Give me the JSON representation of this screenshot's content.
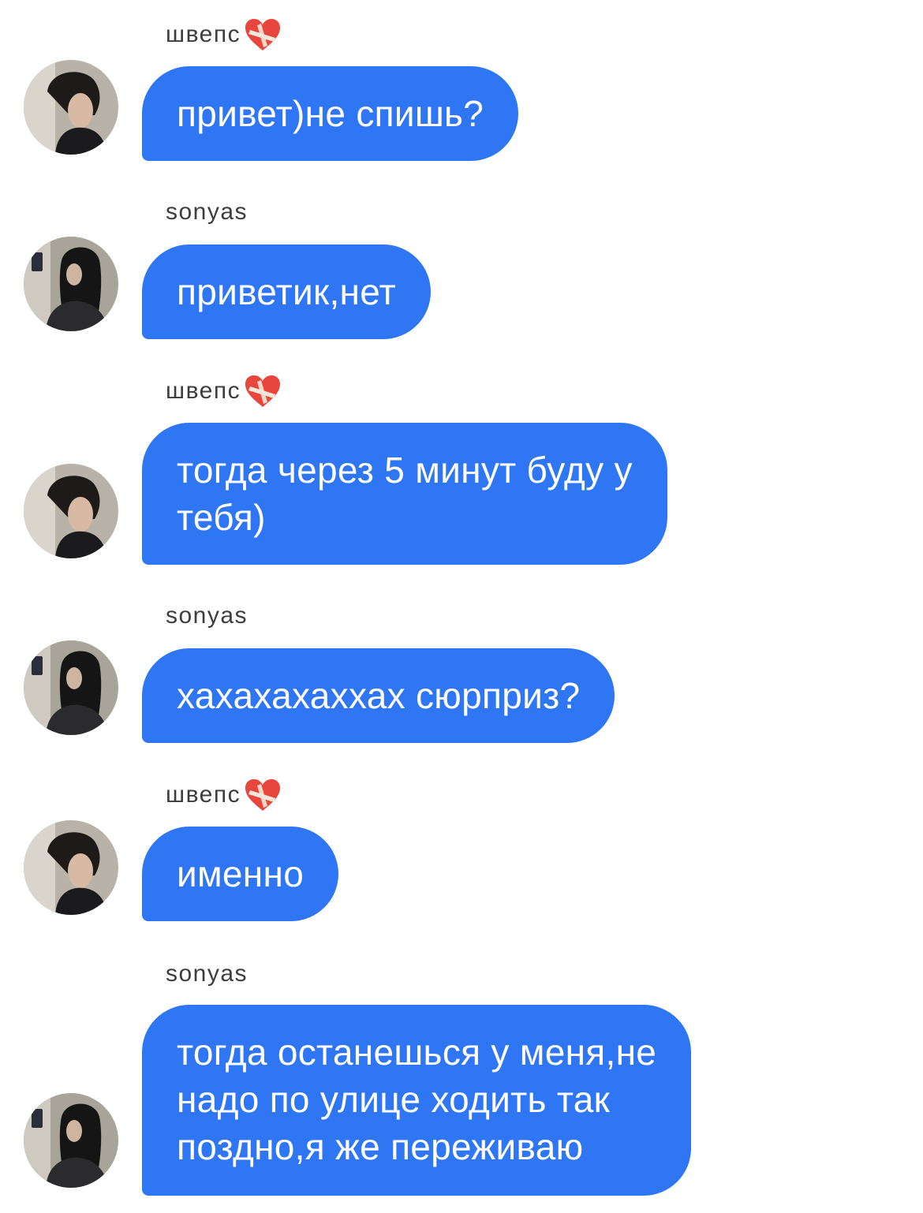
{
  "chat": {
    "messages": [
      {
        "sender": "швепс",
        "has_heart": true,
        "avatar": "guy-avatar",
        "text": "привет)не спишь?"
      },
      {
        "sender": "sonyas",
        "has_heart": false,
        "avatar": "girl-avatar",
        "text": "приветик,нет"
      },
      {
        "sender": "швепс",
        "has_heart": true,
        "avatar": "guy-avatar",
        "text": "тогда через 5 минут буду у\nтебя)"
      },
      {
        "sender": "sonyas",
        "has_heart": false,
        "avatar": "girl-avatar",
        "text": "хахахахаххах сюрприз?"
      },
      {
        "sender": "швепс",
        "has_heart": true,
        "avatar": "guy-avatar",
        "text": "именно"
      },
      {
        "sender": "sonyas",
        "has_heart": false,
        "avatar": "girl-avatar",
        "text": "тогда останешься у меня,не\nнадо по улице ходить так\nпоздно,я же переживаю"
      }
    ]
  },
  "colors": {
    "bubble": "#2f76f5",
    "bubble_text": "#ffffff",
    "sender_text": "#3d3d3d",
    "background": "#ffffff",
    "heart": "#e8463c"
  },
  "icons": {
    "heart": "mending-heart-icon"
  }
}
